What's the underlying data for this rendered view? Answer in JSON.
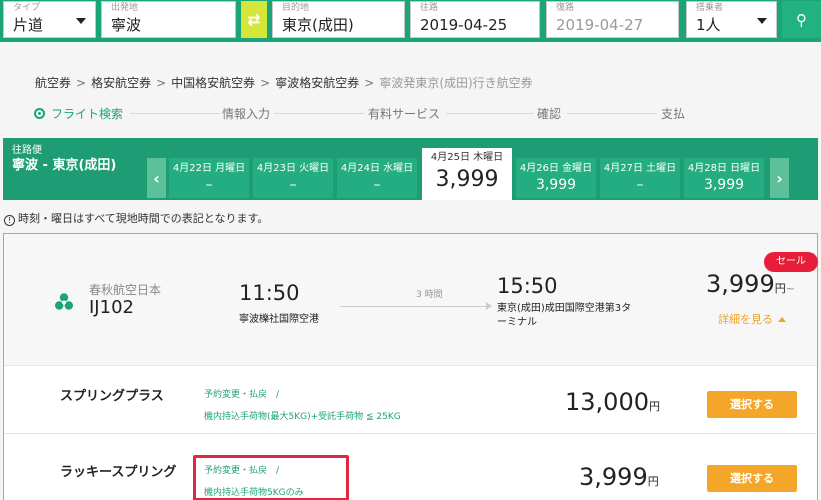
{
  "search": {
    "type_label": "タイプ",
    "type_value": "片道",
    "from_label": "出発地",
    "from_value": "寧波",
    "to_label": "目的地",
    "to_value": "東京(成田)",
    "depart_label": "往路",
    "depart_value": "2019-04-25",
    "return_label": "復路",
    "return_value": "2019-04-27",
    "pax_label": "搭乗者",
    "pax_value": "1人",
    "swap_icon": "⇄",
    "search_icon": "⚲"
  },
  "breadcrumb": {
    "items": [
      "航空券",
      "格安航空券",
      "中国格安航空券",
      "寧波格安航空券"
    ],
    "current": "寧波発東京(成田)行き航空券",
    "separator": ">"
  },
  "steps": {
    "items": [
      "フライト検索",
      "情報入力",
      "有料サービス",
      "確認",
      "支払"
    ]
  },
  "strip": {
    "route_sub": "往路便",
    "route_name": "寧波 - 東京(成田)",
    "prev_icon": "‹",
    "next_icon": "›",
    "days": [
      {
        "date": "4月22日 月曜日",
        "price": "–"
      },
      {
        "date": "4月23日 火曜日",
        "price": "–"
      },
      {
        "date": "4月24日 水曜日",
        "price": "–"
      },
      {
        "date": "4月25日 木曜日",
        "price": "3,999"
      },
      {
        "date": "4月26日 金曜日",
        "price": "3,999"
      },
      {
        "date": "4月27日 土曜日",
        "price": "–"
      },
      {
        "date": "4月28日 日曜日",
        "price": "3,999"
      }
    ]
  },
  "note": {
    "icon": "!",
    "text": "時刻・曜日はすべて現地時間での表記となります。"
  },
  "flight": {
    "airline": "春秋航空日本",
    "number": "IJ102",
    "dep_time": "11:50",
    "dep_airport": "寧波櫟社国際空港",
    "duration": "3 時間",
    "arr_time": "15:50",
    "arr_airport": "東京(成田)成田国際空港第3ターミナル",
    "sale_badge": "セール",
    "price": "3,999",
    "currency": "円",
    "tilde": "~",
    "detail_link": "詳細を見る"
  },
  "fares": [
    {
      "name": "スプリングプラス",
      "cond1": "予約変更・払戻　/",
      "cond2": "機内持込手荷物(最大5KG)+受託手荷物 ≦ 25KG",
      "price": "13,000",
      "currency": "円",
      "button": "選択する"
    },
    {
      "name": "ラッキースプリング",
      "cond1": "予約変更・払戻　/",
      "cond2": "機内持込手荷物5KGのみ",
      "price": "3,999",
      "currency": "円",
      "button": "選択する"
    }
  ],
  "colors": {
    "brand_green": "#1ba37a",
    "accent_orange": "#f4a62a",
    "sale_red": "#e61e3c",
    "swap_yellow": "#d6e53a"
  }
}
